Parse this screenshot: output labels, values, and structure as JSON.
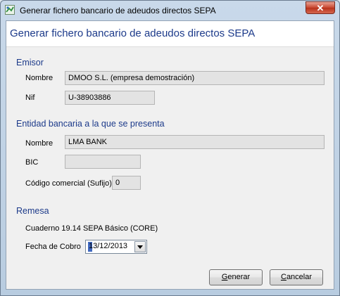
{
  "window": {
    "title": "Generar fichero bancario de adeudos directos SEPA",
    "close_label": "✕"
  },
  "header": {
    "title": "Generar fichero bancario de adeudos directos SEPA"
  },
  "emisor": {
    "section_title": "Emisor",
    "nombre_label": "Nombre",
    "nombre_value": "DMOO S.L. (empresa demostración)",
    "nif_label": "Nif",
    "nif_value": "U-38903886"
  },
  "entidad": {
    "section_title": "Entidad bancaria a la que se presenta",
    "nombre_label": "Nombre",
    "nombre_value": "LMA BANK",
    "bic_label": "BIC",
    "bic_value": "",
    "codigo_label": "Código comercial (Sufijo)",
    "codigo_value": "0"
  },
  "remesa": {
    "section_title": "Remesa",
    "cuaderno_text": "Cuaderno 19.14 SEPA Básico (CORE)",
    "fecha_label": "Fecha de Cobro",
    "fecha_value": "13/12/2013"
  },
  "buttons": {
    "generar_first": "G",
    "generar_rest": "enerar",
    "cancelar_first": "C",
    "cancelar_rest": "ancelar"
  },
  "colors": {
    "accent_text": "#1c3a8a",
    "close_button": "#c7462f"
  }
}
